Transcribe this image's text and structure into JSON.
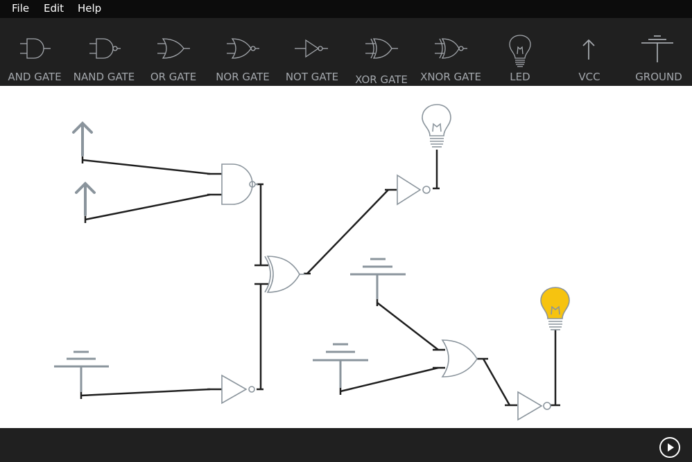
{
  "menu": {
    "items": [
      {
        "label": "File"
      },
      {
        "label": "Edit"
      },
      {
        "label": "Help"
      }
    ]
  },
  "toolbar": {
    "tools": [
      {
        "label": "AND GATE",
        "icon": "and-gate-icon"
      },
      {
        "label": "NAND GATE",
        "icon": "nand-gate-icon"
      },
      {
        "label": "OR GATE",
        "icon": "or-gate-icon"
      },
      {
        "label": "NOR GATE",
        "icon": "nor-gate-icon"
      },
      {
        "label": "NOT GATE",
        "icon": "not-gate-icon"
      },
      {
        "label": "XOR GATE",
        "icon": "xor-gate-icon"
      },
      {
        "label": "XNOR GATE",
        "icon": "xnor-gate-icon"
      },
      {
        "label": "LED",
        "icon": "led-icon"
      },
      {
        "label": "VCC",
        "icon": "vcc-icon"
      },
      {
        "label": "GROUND",
        "icon": "ground-icon"
      }
    ]
  },
  "canvas": {
    "components": [
      {
        "type": "vcc",
        "name": "vcc-1"
      },
      {
        "type": "vcc",
        "name": "vcc-2"
      },
      {
        "type": "nand",
        "name": "nand-gate-1"
      },
      {
        "type": "ground",
        "name": "ground-1"
      },
      {
        "type": "not",
        "name": "not-gate-1"
      },
      {
        "type": "or",
        "name": "or-gate-1"
      },
      {
        "type": "not",
        "name": "not-gate-2"
      },
      {
        "type": "led",
        "name": "led-1",
        "state": "off"
      },
      {
        "type": "ground",
        "name": "ground-2"
      },
      {
        "type": "ground",
        "name": "ground-3"
      },
      {
        "type": "or",
        "name": "or-gate-2"
      },
      {
        "type": "not",
        "name": "not-gate-3"
      },
      {
        "type": "led",
        "name": "led-2",
        "state": "on"
      }
    ]
  },
  "colors": {
    "menubar": "#0c0c0c",
    "toolbar": "#202020",
    "toolbar_label": "#a4a8ad",
    "component_stroke": "#8a949c",
    "wire": "#1e1e1e",
    "led_on": "#f6c310",
    "statusbar": "#202020"
  },
  "statusbar": {
    "play_icon": "play-icon"
  }
}
